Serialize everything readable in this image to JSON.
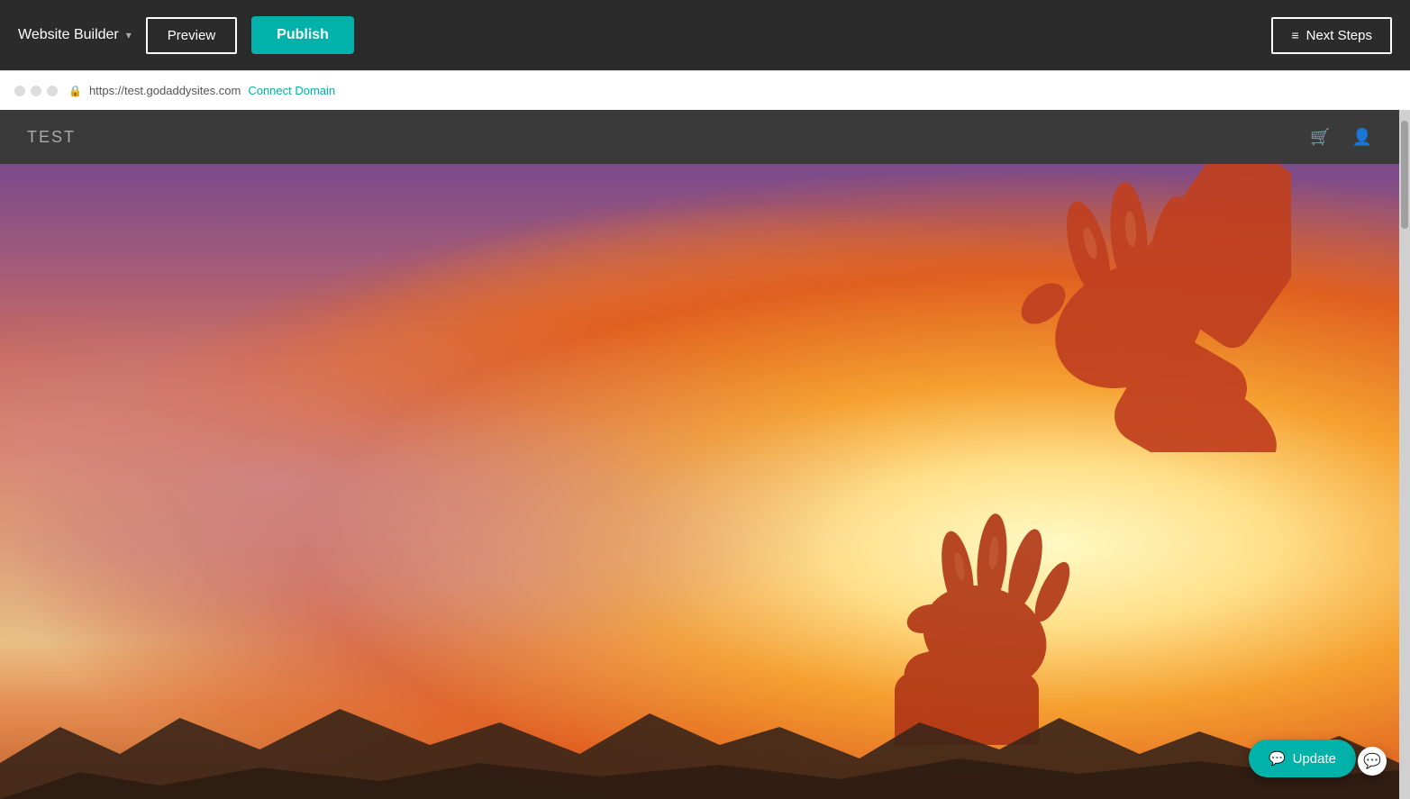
{
  "toolbar": {
    "brand_label": "Website Builder",
    "chevron": "▾",
    "preview_label": "Preview",
    "publish_label": "Publish",
    "next_steps_label": "Next Steps",
    "list_icon": "≡"
  },
  "browser": {
    "url": "https://test.godaddysites.com",
    "connect_domain_label": "Connect Domain",
    "lock_icon": "🔒"
  },
  "site": {
    "title": "TEST",
    "cart_icon": "🛒",
    "user_icon": "👤"
  },
  "chat": {
    "update_label": "Update",
    "bubble_icon": "💬"
  },
  "colors": {
    "toolbar_bg": "#2b2b2b",
    "teal": "#00b2a9",
    "preview_border": "#ffffff"
  }
}
